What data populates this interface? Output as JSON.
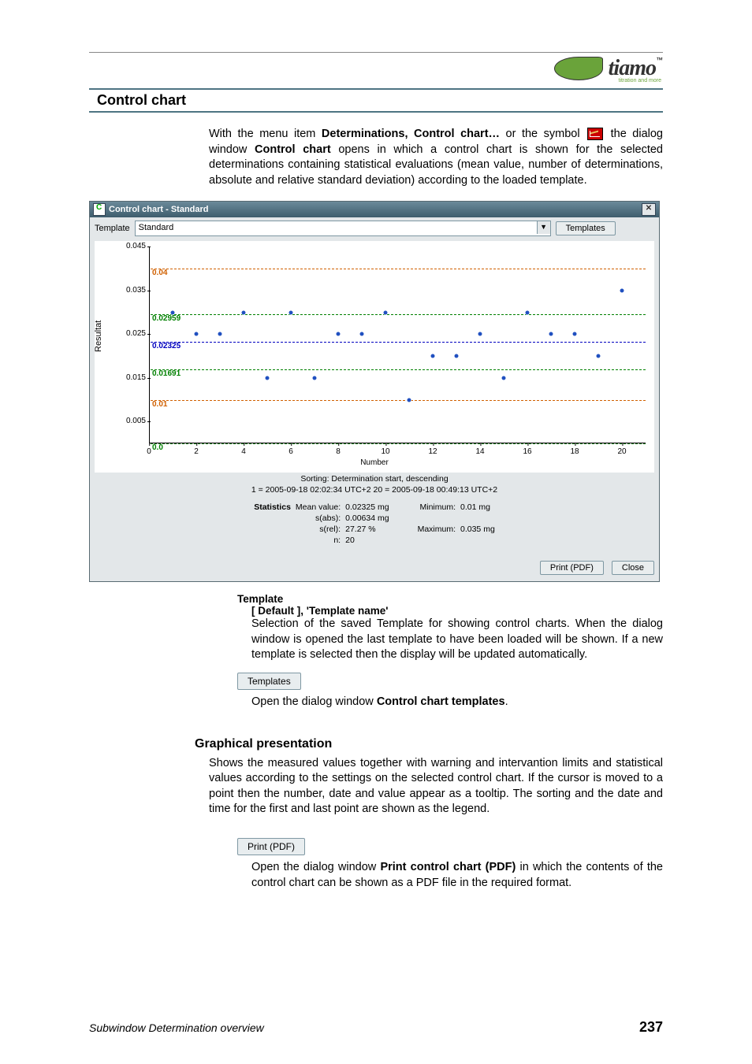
{
  "logo": {
    "brand": "tiamo",
    "tm": "™",
    "sub": "titration and more"
  },
  "section_title": "Control chart",
  "intro": {
    "part1": "With the menu item ",
    "b1": "Determinations, Control chart…",
    "part2": " or the symbol ",
    "part3": " the dialog window ",
    "b2": "Control chart",
    "part4": " opens in which a control chart is shown for the selected determinations containing statistical evaluations (mean value, number of determinations, absolute and relative standard deviation) according to the loaded template."
  },
  "window": {
    "title": "Control chart - Standard",
    "template_label": "Template",
    "template_value": "Standard",
    "templates_btn": "Templates",
    "ylabel": "Resultat",
    "xlabel": "Number",
    "sorting": "Sorting: Determination start, descending",
    "range": "1 = 2005-09-18 02:02:34 UTC+2   20 = 2005-09-18 00:49:13 UTC+2",
    "stats_head": "Statistics",
    "stats_left": {
      "mean_l": "Mean value:",
      "mean_v": "0.02325 mg",
      "sabs_l": "s(abs):",
      "sabs_v": "0.00634 mg",
      "srel_l": "s(rel):",
      "srel_v": "27.27 %",
      "n_l": "n:",
      "n_v": "20"
    },
    "stats_right": {
      "min_l": "Minimum:",
      "min_v": "0.01 mg",
      "max_l": "Maximum:",
      "max_v": "0.035 mg"
    },
    "print_btn": "Print (PDF)",
    "close_btn": "Close"
  },
  "chart_data": {
    "type": "scatter",
    "title": "",
    "ylabel": "Resultat",
    "xlabel": "Number",
    "xlim": [
      0,
      21
    ],
    "ylim": [
      0,
      0.045
    ],
    "yticks": [
      0.005,
      0.015,
      0.025,
      0.035,
      0.045
    ],
    "xticks": [
      0,
      2,
      4,
      6,
      8,
      10,
      12,
      14,
      16,
      18,
      20
    ],
    "reference_lines": [
      {
        "label": "0.04",
        "value": 0.04,
        "color": "#d06000"
      },
      {
        "label": "0.02959",
        "value": 0.02959,
        "color": "#008000"
      },
      {
        "label": "0.02325",
        "value": 0.02325,
        "color": "#0000c0"
      },
      {
        "label": "0.01691",
        "value": 0.01691,
        "color": "#008000"
      },
      {
        "label": "0.01",
        "value": 0.01,
        "color": "#d06000"
      },
      {
        "label": "0.0",
        "value": 0.0,
        "color": "#008000"
      }
    ],
    "series": [
      {
        "name": "Resultat",
        "x": [
          1,
          2,
          3,
          4,
          5,
          6,
          7,
          8,
          9,
          10,
          11,
          12,
          13,
          14,
          15,
          16,
          17,
          18,
          19,
          20
        ],
        "y": [
          0.03,
          0.025,
          0.025,
          0.03,
          0.015,
          0.03,
          0.015,
          0.025,
          0.025,
          0.03,
          0.01,
          0.02,
          0.02,
          0.025,
          0.015,
          0.03,
          0.025,
          0.025,
          0.02,
          0.035
        ]
      }
    ]
  },
  "template_def": {
    "head": "Template",
    "sub": "[ Default ], 'Template name'",
    "text": "Selection of the saved Template for showing control charts. When the dialog window is opened the last template to have been loaded will be shown. If a new template is selected then the display will be updated automatically.",
    "btn": "Templates",
    "after1": "Open the dialog window ",
    "after_b": "Control chart templates",
    "after2": "."
  },
  "graphical": {
    "head": "Graphical presentation",
    "text": "Shows the measured values together with warning and intervantion limits and statistical values according to the settings on the selected control chart. If the cursor is moved to a point then the number, date and value appear as a tooltip. The sorting and the date and time for the first and last point are shown as the legend.",
    "btn": "Print (PDF)",
    "after1": "Open the dialog window ",
    "after_b": "Print control chart (PDF)",
    "after2": " in which the contents of the control chart can be shown as a PDF file in the required format."
  },
  "footer": {
    "left": "Subwindow Determination overview",
    "right": "237"
  }
}
